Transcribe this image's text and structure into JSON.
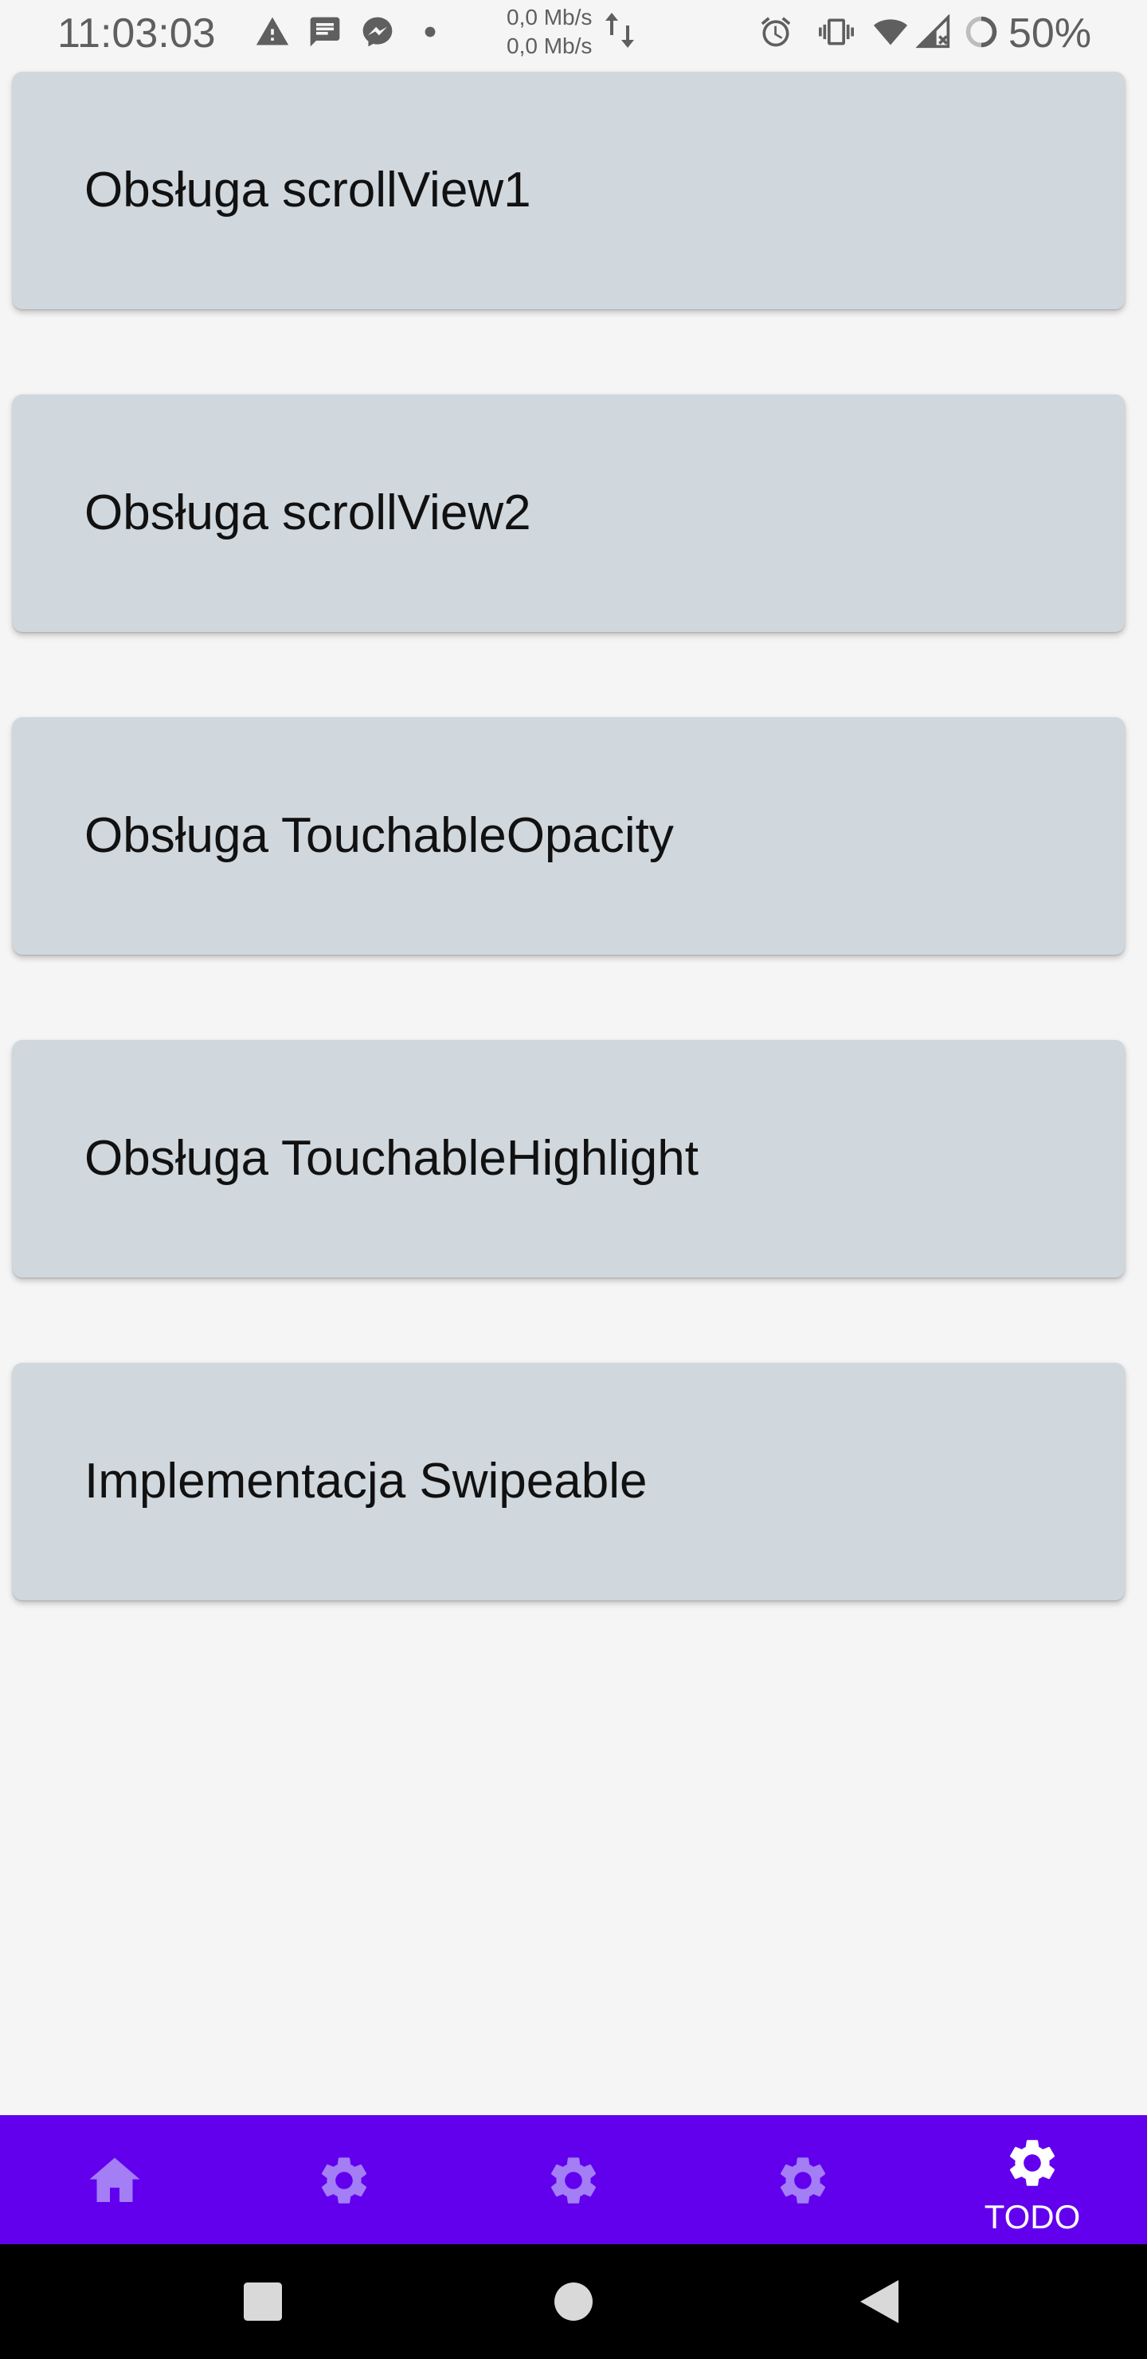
{
  "status_bar": {
    "time": "11:03:03",
    "net_speed_up": "0,0 Mb/s",
    "net_speed_down": "0,0 Mb/s",
    "battery": "50%",
    "icons": [
      "warning-icon",
      "message-icon",
      "messenger-icon",
      "dot-icon",
      "data-arrows-icon",
      "alarm-icon",
      "vibrate-icon",
      "wifi-icon",
      "signal-icon",
      "battery-icon"
    ]
  },
  "cards": [
    {
      "label": "Obsługa scrollView1"
    },
    {
      "label": "Obsługa scrollView2"
    },
    {
      "label": "Obsługa TouchableOpacity"
    },
    {
      "label": "Obsługa TouchableHighlight"
    },
    {
      "label": "Implementacja Swipeable"
    }
  ],
  "tab_bar": {
    "tabs": [
      {
        "icon": "home-icon",
        "label": ""
      },
      {
        "icon": "gear-icon",
        "label": ""
      },
      {
        "icon": "gear-icon",
        "label": ""
      },
      {
        "icon": "gear-icon",
        "label": ""
      },
      {
        "icon": "gear-icon",
        "label": "TODO",
        "active": true
      }
    ]
  },
  "colors": {
    "background": "#f5f5f5",
    "card": "#d0d7dd",
    "tab_bar": "#6200ee",
    "tab_inactive_icon": "#a37ef5",
    "tab_active": "#ffffff",
    "nav_bar": "#000000"
  }
}
